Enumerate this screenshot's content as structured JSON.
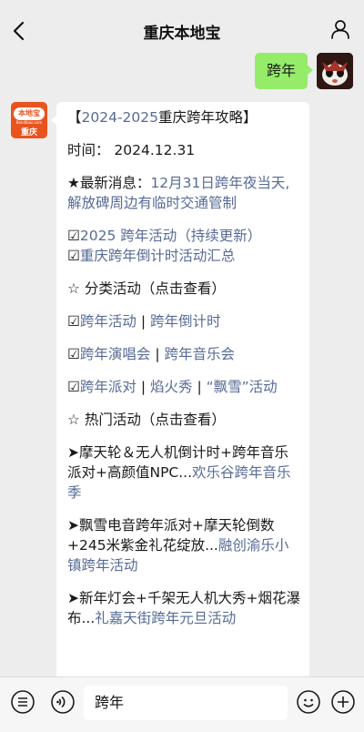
{
  "header": {
    "title": "重庆本地宝"
  },
  "outgoing": {
    "text": "跨年"
  },
  "avatar_logo": {
    "top": "本地宝",
    "mid": "Bendibao.com",
    "bottom": "重庆"
  },
  "message": {
    "title_prefix": "【",
    "title_link": "2024-2025",
    "title_suffix": "重庆跨年攻略】",
    "time": "时间：  2024.12.31",
    "news_prefix": "★最新消息：",
    "news_link": "12月31日跨年夜当天,解放碑周边有临时交通管制",
    "line1_mark": "☑",
    "line1_link": "2025 跨年活动（持续更新）",
    "line2_mark": "☑",
    "line2_link": "重庆跨年倒计时活动汇总",
    "cat_heading": "☆ 分类活动（点击查看）",
    "cat1_mark": "☑",
    "cat1_a": "跨年活动",
    "cat1_sep": " | ",
    "cat1_b": "跨年倒计时",
    "cat2_mark": "☑",
    "cat2_a": "跨年演唱会",
    "cat2_sep": " | ",
    "cat2_b": "跨年音乐会",
    "cat3_mark": "☑",
    "cat3_a": "跨年派对",
    "cat3_sep1": " | ",
    "cat3_b": "焰火秀",
    "cat3_sep2": " | ",
    "cat3_c": "“飘雪”活动",
    "hot_heading": "☆ 热门活动（点击查看）",
    "hot1_text": "➤摩天轮＆无人机倒计时+跨年音乐派对+高颜值NPC...",
    "hot1_link": "欢乐谷跨年音乐季",
    "hot2_text": "➤飘雪电音跨年派对+摩天轮倒数+245米紫金礼花绽放...",
    "hot2_link": "融创渝乐小镇跨年活动",
    "hot3_text": "➤新年灯会+千架无人机大秀+烟花瀑布...",
    "hot3_link": "礼嘉天街跨年元旦活动"
  },
  "input": {
    "value": "跨年"
  },
  "colors": {
    "link": "#576b95",
    "outgoing_bubble": "#95ec69",
    "background": "#ededed"
  }
}
